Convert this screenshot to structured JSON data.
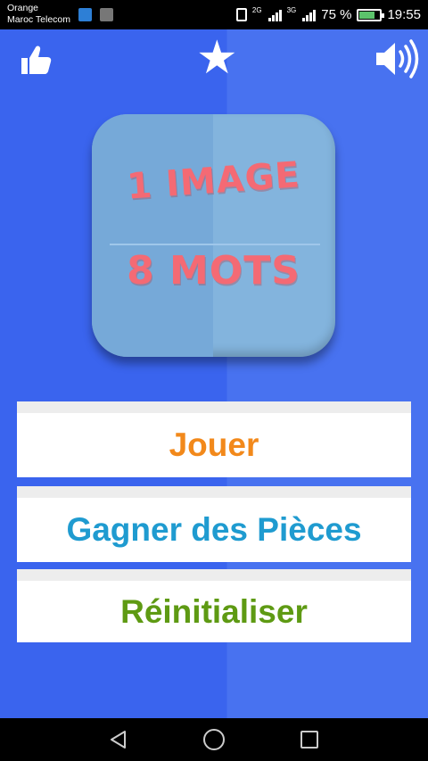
{
  "status_bar": {
    "carrier_line1": "Orange",
    "carrier_line2": "Maroc Telecom",
    "net1": "2G",
    "net2": "3G",
    "battery": "75 %",
    "time": "19:55"
  },
  "toolbar": {
    "like_icon": "thumbs-up-icon",
    "favorite_icon": "star-icon",
    "sound_icon": "speaker-icon"
  },
  "logo": {
    "line1": "1 IMAGE",
    "line2": "8 MOTS"
  },
  "menu": {
    "play": "Jouer",
    "earn_coins": "Gagner des Pièces",
    "reset": "Réinitialiser"
  },
  "colors": {
    "background": "#3a64ee",
    "play": "#f2891b",
    "earn_coins": "#1f9bd0",
    "reset": "#5e9a13",
    "logo_text": "#f46a74"
  }
}
